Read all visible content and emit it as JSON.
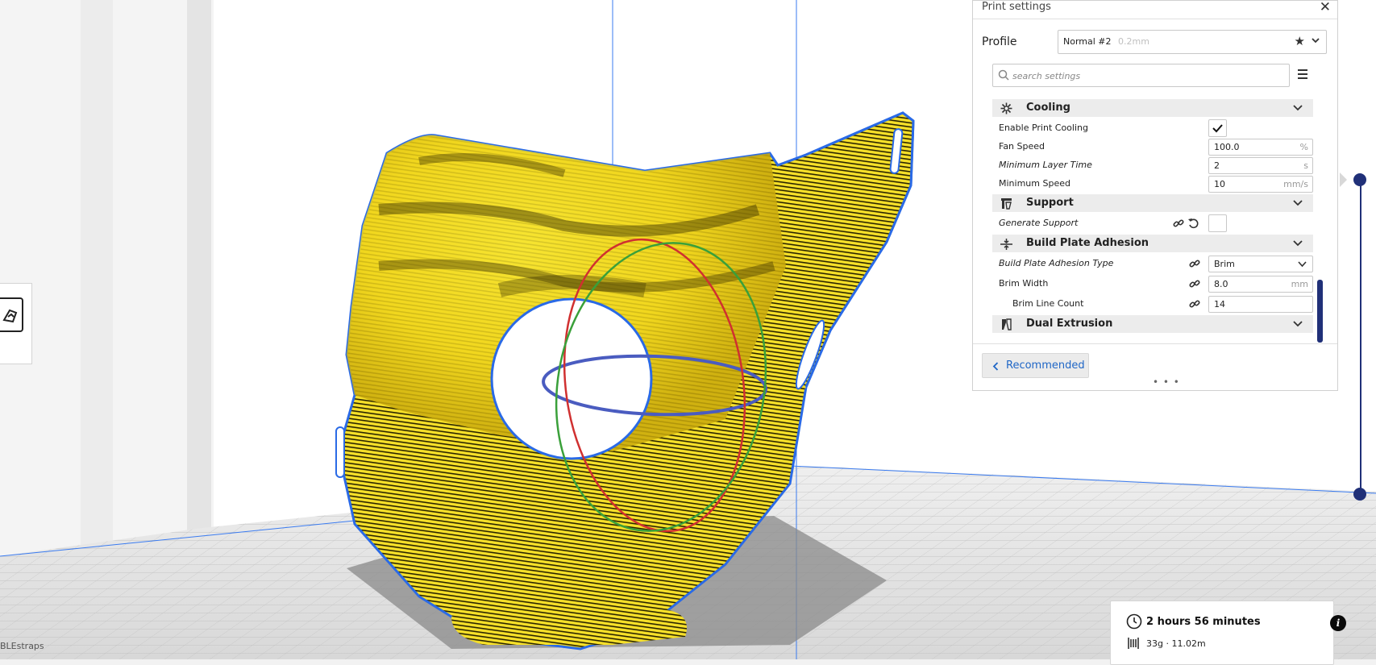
{
  "viewport": {
    "object_name": "BLEstraps",
    "colors": {
      "model": "#f6e029",
      "outline": "#2a6ae6",
      "background": "#ffffff",
      "bed": "#dcdcdc"
    }
  },
  "print_settings": {
    "title": "Print settings",
    "profile_label": "Profile",
    "profile_name": "Normal #2",
    "profile_layer": "0.2mm",
    "search_placeholder": "search settings",
    "categories": [
      {
        "name": "Cooling",
        "icon": "fan-icon",
        "settings": [
          {
            "label": "Enable Print Cooling",
            "type": "checkbox",
            "checked": true
          },
          {
            "label": "Fan Speed",
            "value": "100.0",
            "unit": "%"
          },
          {
            "label": "Minimum Layer Time",
            "value": "2",
            "unit": "s"
          },
          {
            "label": "Minimum Speed",
            "value": "10",
            "unit": "mm/s"
          }
        ]
      },
      {
        "name": "Support",
        "icon": "support-icon",
        "settings": [
          {
            "label": "Generate Support",
            "type": "checkbox",
            "checked": false
          }
        ]
      },
      {
        "name": "Build Plate Adhesion",
        "icon": "adhesion-icon",
        "settings": [
          {
            "label": "Build Plate Adhesion Type",
            "value": "Brim",
            "type": "dropdown"
          },
          {
            "label": "Brim Width",
            "value": "8.0",
            "unit": "mm"
          },
          {
            "label": "Brim Line Count",
            "value": "14"
          }
        ]
      },
      {
        "name": "Dual Extrusion",
        "icon": "dual-extrusion-icon",
        "settings": []
      }
    ],
    "recommended_label": "Recommended",
    "accent_color": "#1f66c6"
  },
  "print_info": {
    "time": "2 hours 56 minutes",
    "material": "33g · 11.02m"
  },
  "slider_color": "#203078"
}
